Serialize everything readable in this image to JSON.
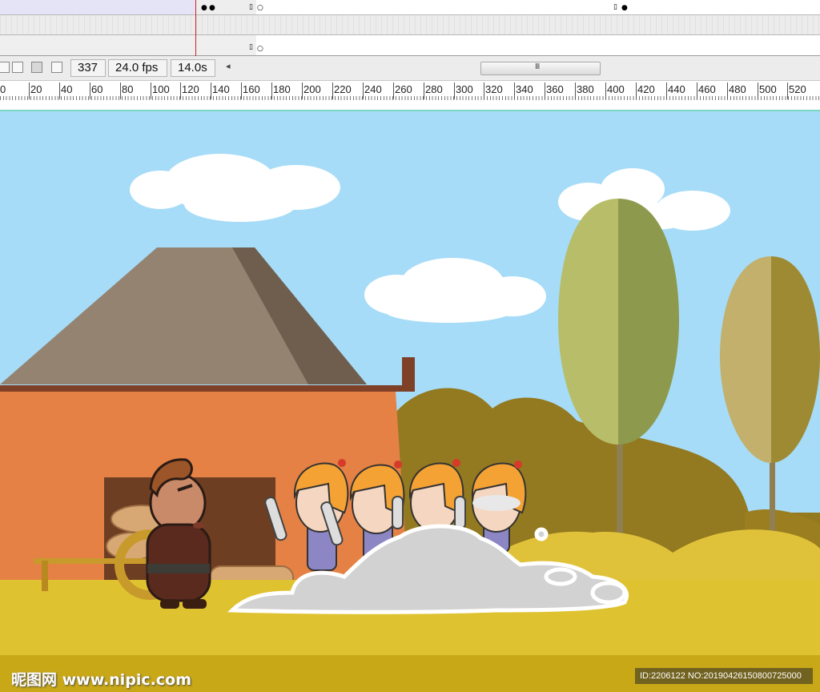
{
  "timeline": {
    "current_frame": "337",
    "frame_rate": "24.0 fps",
    "elapsed_time": "14.0s",
    "scroll_left_arrow": "◂",
    "scroll_grip": "III",
    "ruler_labels": [
      "0",
      "20",
      "40",
      "60",
      "80",
      "100",
      "120",
      "140",
      "160",
      "180",
      "200",
      "220",
      "240",
      "260",
      "280",
      "300",
      "320",
      "340",
      "360",
      "380",
      "400",
      "420",
      "440",
      "460",
      "480",
      "500",
      "520"
    ]
  },
  "toolbar_icons": [
    "onion-skin-icon",
    "onion-outline-icon",
    "edit-multiple-frames-icon",
    "modify-onion-markers-icon"
  ],
  "scene": {
    "characters": [
      "officer",
      "soldier",
      "soldier",
      "soldier",
      "soldier"
    ],
    "colors": {
      "sky": "#a6dcf7",
      "roof_light": "#958371",
      "roof_dark": "#6e5c4c",
      "wall": "#e58144",
      "ground": "#dfc22f",
      "helmet": "#f5a234",
      "dust": "#d0d0d0"
    }
  },
  "watermark": {
    "left": "昵图网 www.nipic.com",
    "right": "ID:2206122 NO:20190426150800725000"
  }
}
